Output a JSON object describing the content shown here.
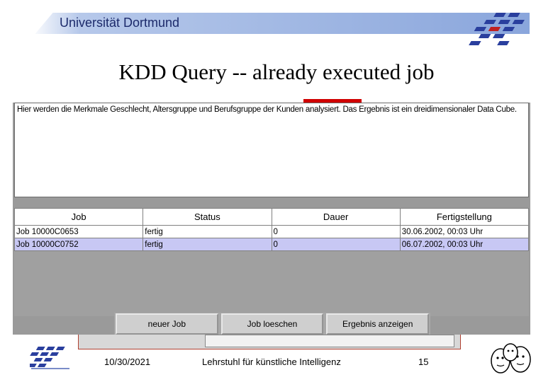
{
  "header": {
    "university": "Universität Dortmund"
  },
  "slide": {
    "title": "KDD Query  --  already executed job"
  },
  "app": {
    "description": "Hier werden die Merkmale Geschlecht, Altersgruppe und Berufsgruppe der Kunden analysiert. Das Ergebnis ist ein dreidimensionaler Data Cube.",
    "table": {
      "headers": [
        "Job",
        "Status",
        "Dauer",
        "Fertigstellung"
      ],
      "rows": [
        [
          "Job 10000C0653",
          "fertig",
          "0",
          "30.06.2002, 00:03 Uhr"
        ],
        [
          "Job 10000C0752",
          "fertig",
          "0",
          "06.07.2002, 00:03 Uhr"
        ]
      ],
      "selected_row": 1
    },
    "buttons": {
      "new_job": "neuer Job",
      "delete_job": "Job loeschen",
      "show_result": "Ergebnis anzeigen"
    }
  },
  "footer": {
    "date": "10/30/2021",
    "chair": "Lehrstuhl für künstliche Intelligenz",
    "page": "15"
  },
  "colors": {
    "header_band": "#8aa6dc",
    "selected_row": "#c8c8f4",
    "accent_red": "#d00000"
  },
  "icons": [
    "university-logo-icon",
    "mascot-icon"
  ]
}
